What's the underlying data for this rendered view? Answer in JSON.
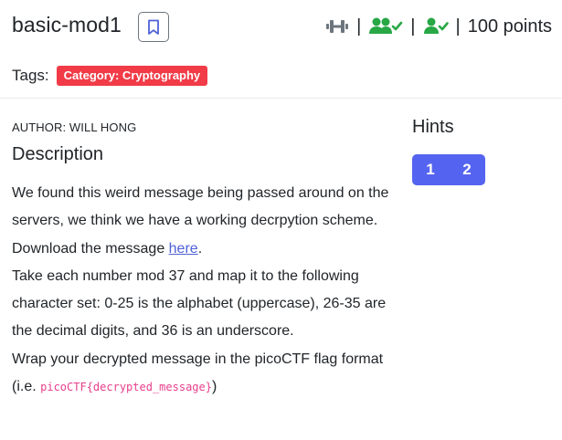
{
  "challenge": {
    "title": "basic-mod1",
    "points": "100 points",
    "tags_label": "Tags:",
    "tag": "Category: Cryptography",
    "author": "AUTHOR: WILL HONG",
    "description_heading": "Description",
    "description": {
      "line1": "We found this weird message being passed around on the servers, we think we have a working decrpytion scheme.",
      "download_prefix": "Download the message ",
      "download_link": "here",
      "download_suffix": ".",
      "line3": "Take each number mod 37 and map it to the following character set: 0-25 is the alphabet (uppercase), 26-35 are the decimal digits, and 36 is an underscore.",
      "line4_prefix": "Wrap your decrypted message in the picoCTF flag format (i.e. ",
      "flag_format": "picoCTF{decrypted_message}",
      "line4_suffix": ")"
    }
  },
  "stats": {
    "difficulty_icon": "dumbbell-icon",
    "solves_icon": "users-check-icon",
    "solved_icon": "user-check-icon",
    "separator": "|"
  },
  "hints": {
    "heading": "Hints",
    "buttons": [
      "1",
      "2"
    ]
  },
  "colors": {
    "tag_bg": "#f13b47",
    "hint_bg": "#5564f0",
    "green": "#28a745",
    "link": "#4f61d7",
    "code": "#e83e8c"
  }
}
